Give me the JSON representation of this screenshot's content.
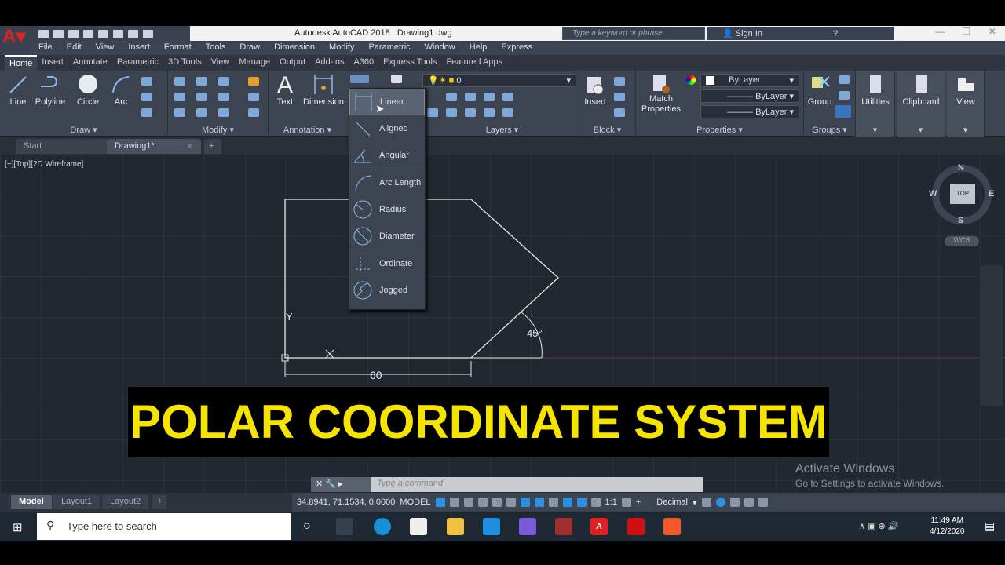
{
  "app": {
    "title": "Autodesk AutoCAD 2018",
    "document": "Drawing1.dwg",
    "search_placeholder": "Type a keyword or phrase",
    "sign_in": "Sign In"
  },
  "menu": [
    "File",
    "Edit",
    "View",
    "Insert",
    "Format",
    "Tools",
    "Draw",
    "Dimension",
    "Modify",
    "Parametric",
    "Window",
    "Help",
    "Express"
  ],
  "ribbon_tabs": [
    "Home",
    "Insert",
    "Annotate",
    "Parametric",
    "3D Tools",
    "View",
    "Manage",
    "Output",
    "Add-ins",
    "A360",
    "Express Tools",
    "Featured Apps"
  ],
  "panels": {
    "draw": {
      "title": "Draw",
      "tools": [
        "Line",
        "Polyline",
        "Circle",
        "Arc"
      ]
    },
    "modify": {
      "title": "Modify"
    },
    "annotation": {
      "title": "Annotation",
      "tools": [
        "Text",
        "Dimension"
      ]
    },
    "layers": {
      "title": "Layers",
      "layer": "0"
    },
    "block": {
      "title": "Block",
      "tools": [
        "Insert"
      ]
    },
    "properties": {
      "title": "Properties",
      "match": "Match Properties",
      "color": "ByLayer",
      "linetype": "ByLayer",
      "lineweight": "ByLayer"
    },
    "groups": {
      "title": "Groups",
      "tools": [
        "Group"
      ]
    },
    "utilities": "Utilities",
    "clipboard": "Clipboard",
    "view": "View"
  },
  "dim_menu": [
    "Linear",
    "Aligned",
    "Angular",
    "Arc Length",
    "Radius",
    "Diameter",
    "Ordinate",
    "Jogged"
  ],
  "dim_menu_selected": "Linear",
  "file_tabs": [
    "Start",
    "Drawing1*"
  ],
  "viewport_label": "[−][Top][2D Wireframe]",
  "viewcube": {
    "n": "N",
    "s": "S",
    "e": "E",
    "w": "W",
    "top": "TOP",
    "wcs": "WCS"
  },
  "drawing": {
    "dimension": "60",
    "angle": "45°",
    "ucs_y": "Y"
  },
  "banner": "POLAR COORDINATE SYSTEM",
  "activate": {
    "title": "Activate Windows",
    "sub": "Go to Settings to activate Windows."
  },
  "command_placeholder": "Type a command",
  "layout_tabs": [
    "Model",
    "Layout1",
    "Layout2"
  ],
  "status": {
    "coords": "34.8941, 71.1534, 0.0000",
    "space": "MODEL",
    "scale": "1:1",
    "units": "Decimal"
  },
  "taskbar": {
    "search": "Type here to search",
    "time": "11:49 AM",
    "date": "4/12/2020"
  },
  "colors": {
    "banner_text": "#f5e400",
    "accent": "#2f8fe0",
    "canvas": "#212830"
  }
}
